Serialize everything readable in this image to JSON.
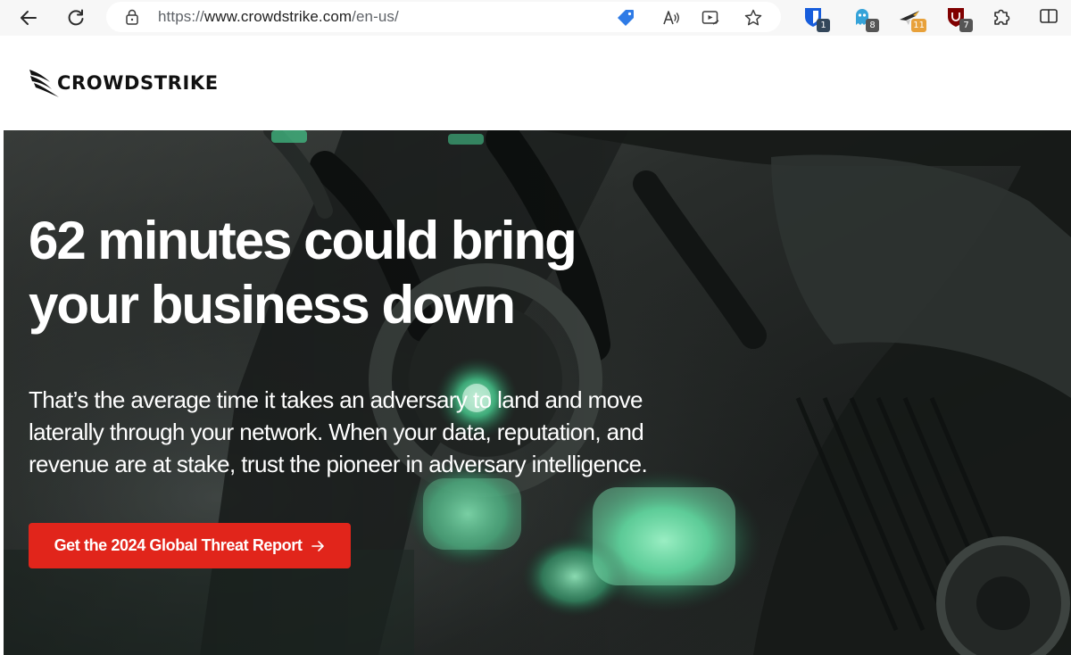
{
  "browser": {
    "url_prefix": "https://",
    "url_host": "www.crowdstrike.com",
    "url_path": "/en-us/",
    "extensions": [
      {
        "name": "bitwarden",
        "badge": "1"
      },
      {
        "name": "ghostery",
        "badge": "8"
      },
      {
        "name": "vpn-extension",
        "badge": "11"
      },
      {
        "name": "ublock",
        "badge": "7"
      }
    ]
  },
  "site": {
    "logo_text": "CROWDSTRIKE"
  },
  "hero": {
    "title_line1": "62 minutes could bring",
    "title_line2": "your business down",
    "subtitle": "That’s the average time it takes an adversary to land and move laterally through your network. When your data, reputation, and revenue are at stake, trust the pioneer in adversary intelligence.",
    "cta_label": "Get the 2024 Global Threat Report",
    "cta_arrow": "→"
  },
  "colors": {
    "cta": "#e1251b",
    "hero_glow": "#4de6a0",
    "hero_dark": "#1e2220"
  }
}
